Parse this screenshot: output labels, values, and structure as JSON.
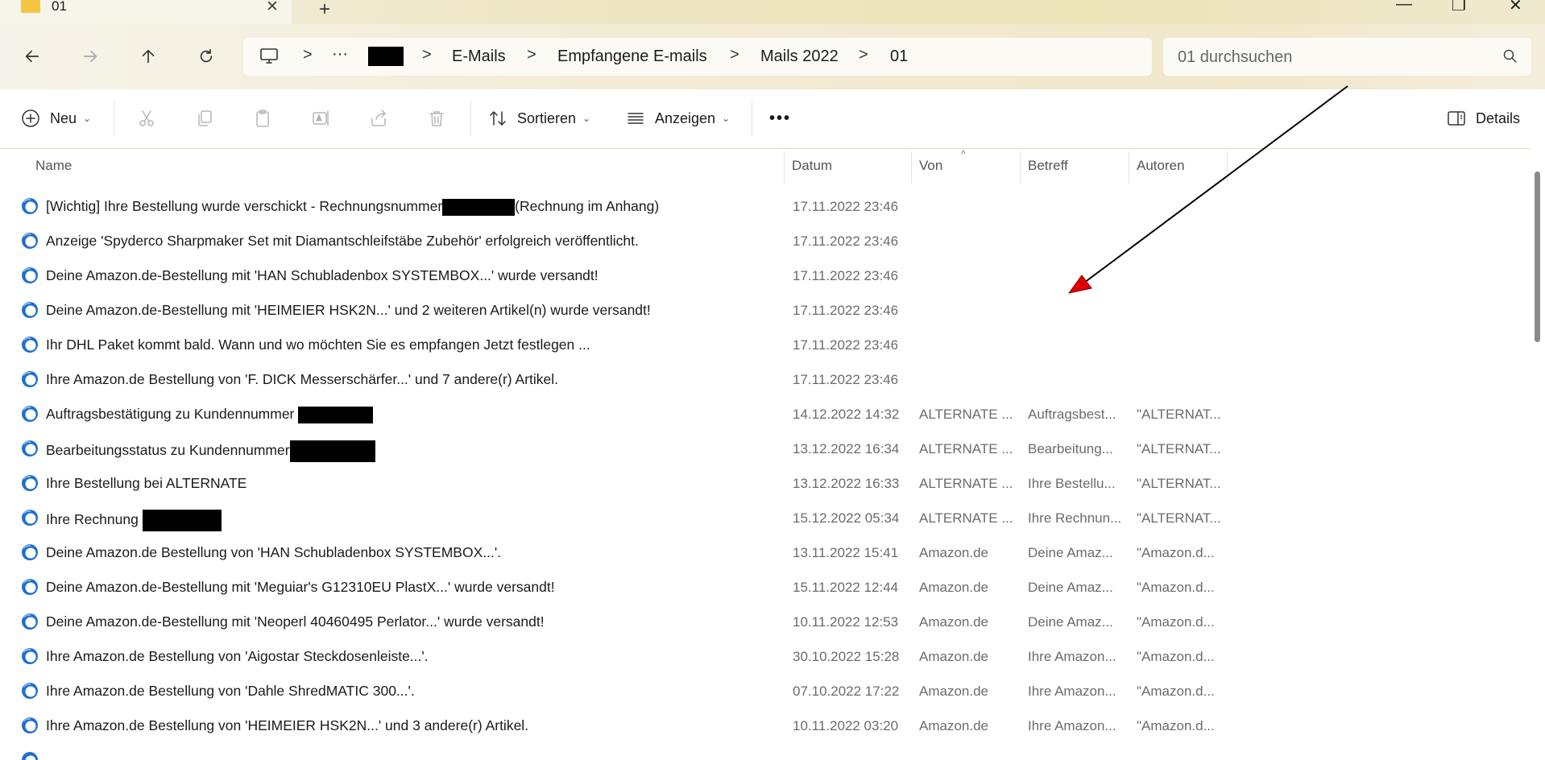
{
  "window": {
    "tab_title": "01",
    "close_glyph": "✕",
    "new_tab_glyph": "+",
    "minimize_glyph": "—",
    "restore_glyph": "❐",
    "window_close_glyph": "✕"
  },
  "nav": {
    "back_icon": "arrow-left-icon",
    "forward_icon": "arrow-right-icon",
    "up_icon": "arrow-up-icon",
    "refresh_icon": "refresh-icon"
  },
  "breadcrumb": {
    "computer_icon": "monitor-icon",
    "ellipsis": "···",
    "sep": ">",
    "items": [
      "E-Mails",
      "Empfangene E-mails",
      "Mails 2022",
      "01"
    ]
  },
  "search": {
    "placeholder": "01 durchsuchen"
  },
  "commands": {
    "new_label": "Neu",
    "sort_label": "Sortieren",
    "view_label": "Anzeigen",
    "more_label": "•••",
    "details_label": "Details"
  },
  "columns": {
    "name": "Name",
    "date": "Datum",
    "from": "Von",
    "subject": "Betreff",
    "authors": "Autoren"
  },
  "rows": [
    {
      "name_before": "[Wichtig] Ihre Bestellung wurde verschickt - Rechnungsnummer",
      "name_after": "(Rechnung im Anhang)",
      "date": "17.11.2022 23:46",
      "von": "",
      "betreff": "",
      "autoren": ""
    },
    {
      "name_before": "Anzeige 'Spyderco Sharpmaker Set mit Diamantschleifstäbe Zubehör' erfolgreich veröffentlicht.",
      "name_after": "",
      "date": "17.11.2022 23:46",
      "von": "",
      "betreff": "",
      "autoren": ""
    },
    {
      "name_before": "Deine Amazon.de-Bestellung mit 'HAN Schubladenbox SYSTEMBOX...' wurde versandt!",
      "name_after": "",
      "date": "17.11.2022 23:46",
      "von": "",
      "betreff": "",
      "autoren": ""
    },
    {
      "name_before": "Deine Amazon.de-Bestellung mit 'HEIMEIER HSK2N...' und 2 weiteren Artikel(n) wurde versandt!",
      "name_after": "",
      "date": "17.11.2022 23:46",
      "von": "",
      "betreff": "",
      "autoren": ""
    },
    {
      "name_before": "Ihr DHL Paket kommt bald. Wann und wo möchten Sie es empfangen Jetzt festlegen ...",
      "name_after": "",
      "date": "17.11.2022 23:46",
      "von": "",
      "betreff": "",
      "autoren": ""
    },
    {
      "name_before": "Ihre Amazon.de Bestellung von 'F. DICK Messerschärfer...' und 7 andere(r) Artikel.",
      "name_after": "",
      "date": "17.11.2022 23:46",
      "von": "",
      "betreff": "",
      "autoren": ""
    },
    {
      "name_before": "Auftragsbestätigung zu Kundennummer ",
      "name_after": "",
      "date": "14.12.2022 14:32",
      "von": "ALTERNATE ...",
      "betreff": "Auftragsbest...",
      "autoren": "\"ALTERNAT..."
    },
    {
      "name_before": "Bearbeitungsstatus zu Kundennummer",
      "name_after": "",
      "date": "13.12.2022 16:34",
      "von": "ALTERNATE ...",
      "betreff": "Bearbeitung...",
      "autoren": "\"ALTERNAT..."
    },
    {
      "name_before": "Ihre Bestellung bei ALTERNATE",
      "name_after": "",
      "date": "13.12.2022 16:33",
      "von": "ALTERNATE ...",
      "betreff": "Ihre Bestellu...",
      "autoren": "\"ALTERNAT..."
    },
    {
      "name_before": "Ihre Rechnung ",
      "name_after": "",
      "date": "15.12.2022 05:34",
      "von": "ALTERNATE ...",
      "betreff": "Ihre Rechnun...",
      "autoren": "\"ALTERNAT..."
    },
    {
      "name_before": "Deine Amazon.de Bestellung von 'HAN Schubladenbox SYSTEMBOX...'.",
      "name_after": "",
      "date": "13.11.2022 15:41",
      "von": "Amazon.de",
      "betreff": "Deine Amaz...",
      "autoren": "\"Amazon.d..."
    },
    {
      "name_before": "Deine Amazon.de-Bestellung mit 'Meguiar's G12310EU PlastX...' wurde versandt!",
      "name_after": "",
      "date": "15.11.2022 12:44",
      "von": "Amazon.de",
      "betreff": "Deine Amaz...",
      "autoren": "\"Amazon.d..."
    },
    {
      "name_before": "Deine Amazon.de-Bestellung mit 'Neoperl 40460495 Perlator...' wurde versandt!",
      "name_after": "",
      "date": "10.11.2022 12:53",
      "von": "Amazon.de",
      "betreff": "Deine Amaz...",
      "autoren": "\"Amazon.d..."
    },
    {
      "name_before": "Ihre Amazon.de Bestellung von 'Aigostar Steckdosenleiste...'.",
      "name_after": "",
      "date": "30.10.2022 15:28",
      "von": "Amazon.de",
      "betreff": "Ihre Amazon...",
      "autoren": "\"Amazon.d..."
    },
    {
      "name_before": "Ihre Amazon.de Bestellung von 'Dahle ShredMATIC 300...'.",
      "name_after": "",
      "date": "07.10.2022 17:22",
      "von": "Amazon.de",
      "betreff": "Ihre Amazon...",
      "autoren": "\"Amazon.d..."
    },
    {
      "name_before": "Ihre Amazon.de Bestellung von 'HEIMEIER HSK2N...' und 3 andere(r) Artikel.",
      "name_after": "",
      "date": "10.11.2022 03:20",
      "von": "Amazon.de",
      "betreff": "Ihre Amazon...",
      "autoren": "\"Amazon.d..."
    }
  ],
  "colors": {
    "accent": "#1f6fd1",
    "annotation_arrow": "#e00000",
    "titlebar_tint": "#ece3b7"
  }
}
